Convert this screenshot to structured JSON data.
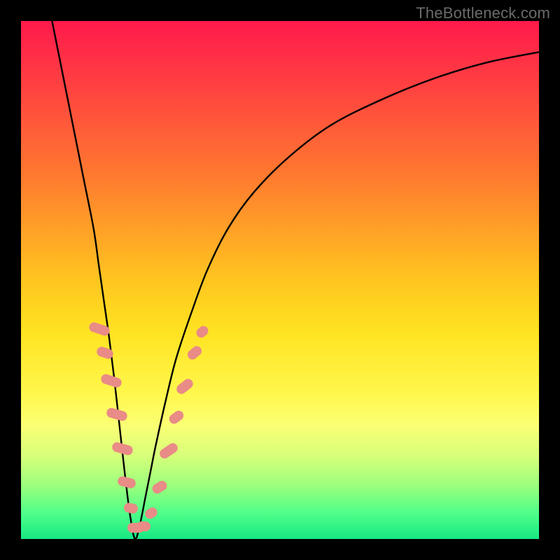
{
  "watermark": "TheBottleneck.com",
  "chart_data": {
    "type": "line",
    "title": "",
    "xlabel": "",
    "ylabel": "",
    "xlim": [
      0,
      100
    ],
    "ylim": [
      0,
      100
    ],
    "grid": false,
    "legend": false,
    "description": "Bottleneck percentage curve over red-yellow-green gradient. Minimum near x≈22. Salmon pill markers cluster along the two arms of the V near the bottom.",
    "gradient_stops": [
      {
        "offset": 0.0,
        "color": "#ff1a4b"
      },
      {
        "offset": 0.12,
        "color": "#ff3f41"
      },
      {
        "offset": 0.3,
        "color": "#ff7a2f"
      },
      {
        "offset": 0.5,
        "color": "#ffc51f"
      },
      {
        "offset": 0.6,
        "color": "#ffe321"
      },
      {
        "offset": 0.72,
        "color": "#fff74d"
      },
      {
        "offset": 0.78,
        "color": "#fbff74"
      },
      {
        "offset": 0.84,
        "color": "#d6ff7a"
      },
      {
        "offset": 0.9,
        "color": "#98ff7d"
      },
      {
        "offset": 0.95,
        "color": "#4fff89"
      },
      {
        "offset": 1.0,
        "color": "#17e884"
      }
    ],
    "series": [
      {
        "name": "bottleneck-curve",
        "x": [
          6,
          8,
          10,
          12,
          14,
          15,
          16,
          17,
          18,
          19,
          20,
          21,
          22,
          23,
          24,
          25,
          26,
          28,
          30,
          33,
          36,
          40,
          45,
          52,
          60,
          70,
          80,
          90,
          100
        ],
        "y": [
          100,
          90,
          80,
          70,
          60,
          53,
          46,
          39,
          31,
          22,
          13,
          5,
          0,
          3,
          8,
          13,
          18,
          27,
          35,
          44,
          52,
          60,
          67,
          74,
          80,
          85,
          89,
          92,
          94
        ]
      }
    ],
    "markers": {
      "name": "highlight-pills",
      "color": "#e98b86",
      "points": [
        {
          "x": 15.2,
          "y": 40.5,
          "w": 14,
          "h": 30,
          "rot": -72
        },
        {
          "x": 16.2,
          "y": 36.0,
          "w": 14,
          "h": 24,
          "rot": -72
        },
        {
          "x": 17.4,
          "y": 30.5,
          "w": 14,
          "h": 30,
          "rot": -72
        },
        {
          "x": 18.5,
          "y": 24.0,
          "w": 14,
          "h": 30,
          "rot": -74
        },
        {
          "x": 19.6,
          "y": 17.5,
          "w": 14,
          "h": 30,
          "rot": -74
        },
        {
          "x": 20.4,
          "y": 11.0,
          "w": 14,
          "h": 26,
          "rot": -76
        },
        {
          "x": 21.2,
          "y": 6.0,
          "w": 14,
          "h": 20,
          "rot": -78
        },
        {
          "x": 22.2,
          "y": 2.2,
          "w": 24,
          "h": 14,
          "rot": 0
        },
        {
          "x": 23.6,
          "y": 2.4,
          "w": 20,
          "h": 14,
          "rot": 0
        },
        {
          "x": 25.2,
          "y": 5.0,
          "w": 14,
          "h": 18,
          "rot": 58
        },
        {
          "x": 26.8,
          "y": 10.0,
          "w": 14,
          "h": 22,
          "rot": 58
        },
        {
          "x": 28.5,
          "y": 17.0,
          "w": 14,
          "h": 28,
          "rot": 56
        },
        {
          "x": 30.0,
          "y": 23.5,
          "w": 14,
          "h": 22,
          "rot": 54
        },
        {
          "x": 31.6,
          "y": 29.5,
          "w": 14,
          "h": 26,
          "rot": 52
        },
        {
          "x": 33.5,
          "y": 36.0,
          "w": 14,
          "h": 22,
          "rot": 50
        },
        {
          "x": 35.0,
          "y": 40.0,
          "w": 14,
          "h": 18,
          "rot": 48
        }
      ]
    }
  }
}
